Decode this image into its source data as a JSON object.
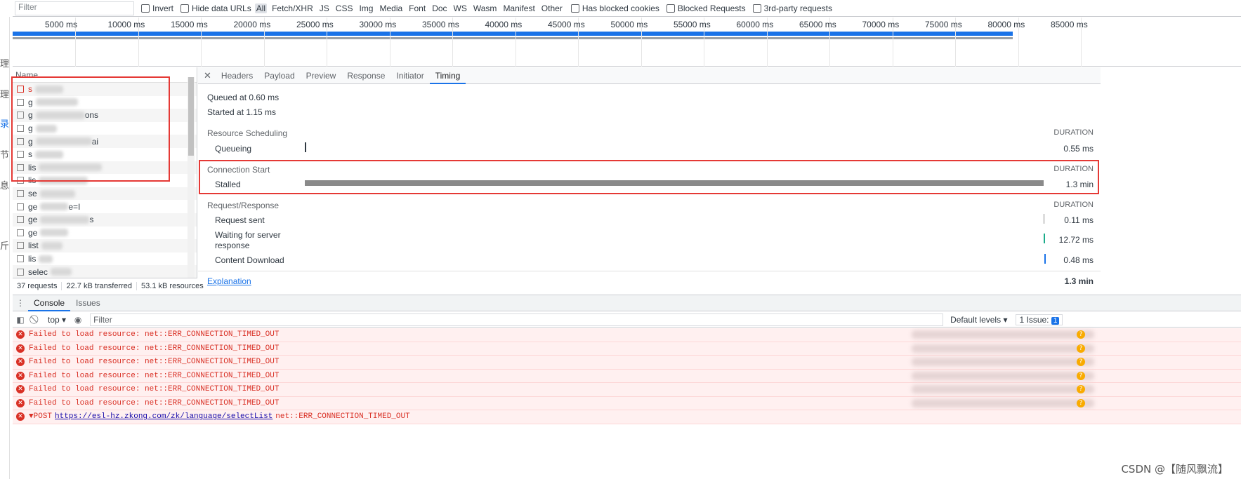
{
  "filter_bar": {
    "filter_placeholder": "Filter",
    "invert": "Invert",
    "hide_data_urls": "Hide data URLs",
    "types": [
      "All",
      "Fetch/XHR",
      "JS",
      "CSS",
      "Img",
      "Media",
      "Font",
      "Doc",
      "WS",
      "Wasm",
      "Manifest",
      "Other"
    ],
    "has_blocked_cookies": "Has blocked cookies",
    "blocked_requests": "Blocked Requests",
    "third_party": "3rd-party requests"
  },
  "left_strip_chars": [
    "理",
    "理",
    "录",
    "节",
    "息",
    "斤"
  ],
  "overview": {
    "ticks": [
      "5000 ms",
      "10000 ms",
      "15000 ms",
      "20000 ms",
      "25000 ms",
      "30000 ms",
      "35000 ms",
      "40000 ms",
      "45000 ms",
      "50000 ms",
      "55000 ms",
      "60000 ms",
      "65000 ms",
      "70000 ms",
      "75000 ms",
      "80000 ms",
      "85000 ms"
    ]
  },
  "requests": {
    "header": "Name",
    "rows": [
      "s",
      "g",
      "g",
      "g",
      "g",
      "s",
      "lis",
      "lis",
      "se",
      "ge",
      "ge",
      "ge",
      "list",
      "lis",
      "selec"
    ],
    "suffixes": [
      "",
      "",
      "ons",
      "",
      "ai",
      "",
      "",
      "",
      "",
      "e=I",
      "s",
      "",
      "",
      "",
      ""
    ],
    "footer": {
      "requests": "37 requests",
      "transferred": "22.7 kB transferred",
      "resources": "53.1 kB resources"
    }
  },
  "details": {
    "tabs": [
      "Headers",
      "Payload",
      "Preview",
      "Response",
      "Initiator",
      "Timing"
    ],
    "active_tab": "Timing",
    "queued": "Queued at 0.60 ms",
    "started": "Started at 1.15 ms",
    "duration_label": "DURATION",
    "sections": {
      "scheduling": "Resource Scheduling",
      "connection": "Connection Start",
      "request": "Request/Response"
    },
    "rows": {
      "queueing": {
        "label": "Queueing",
        "value": "0.55 ms"
      },
      "stalled": {
        "label": "Stalled",
        "value": "1.3 min"
      },
      "request_sent": {
        "label": "Request sent",
        "value": "0.11 ms"
      },
      "waiting": {
        "label": "Waiting for server response",
        "value": "12.72 ms"
      },
      "download": {
        "label": "Content Download",
        "value": "0.48 ms"
      }
    },
    "explanation": "Explanation",
    "total": "1.3 min",
    "colors": {
      "stalled": "#8a8a8a",
      "waiting": "#1bab8a",
      "download": "#1a73e8",
      "redbox": "#e53935"
    }
  },
  "drawer": {
    "tabs": [
      "Console",
      "Issues"
    ],
    "active_tab": "Console",
    "context": "top",
    "filter_placeholder": "Filter",
    "levels": "Default levels",
    "issues_label": "1 Issue:",
    "issues_count": "1"
  },
  "console": {
    "messages": [
      "Failed to load resource: net::ERR_CONNECTION_TIMED_OUT",
      "Failed to load resource: net::ERR_CONNECTION_TIMED_OUT",
      "Failed to load resource: net::ERR_CONNECTION_TIMED_OUT",
      "Failed to load resource: net::ERR_CONNECTION_TIMED_OUT",
      "Failed to load resource: net::ERR_CONNECTION_TIMED_OUT",
      "Failed to load resource: net::ERR_CONNECTION_TIMED_OUT"
    ],
    "post_prefix": "▼POST",
    "post_url": "https://esl-hz.zkong.com/zk/language/selectList",
    "post_error": "net::ERR_CONNECTION_TIMED_OUT"
  },
  "watermark": "CSDN @【随风飘流】"
}
